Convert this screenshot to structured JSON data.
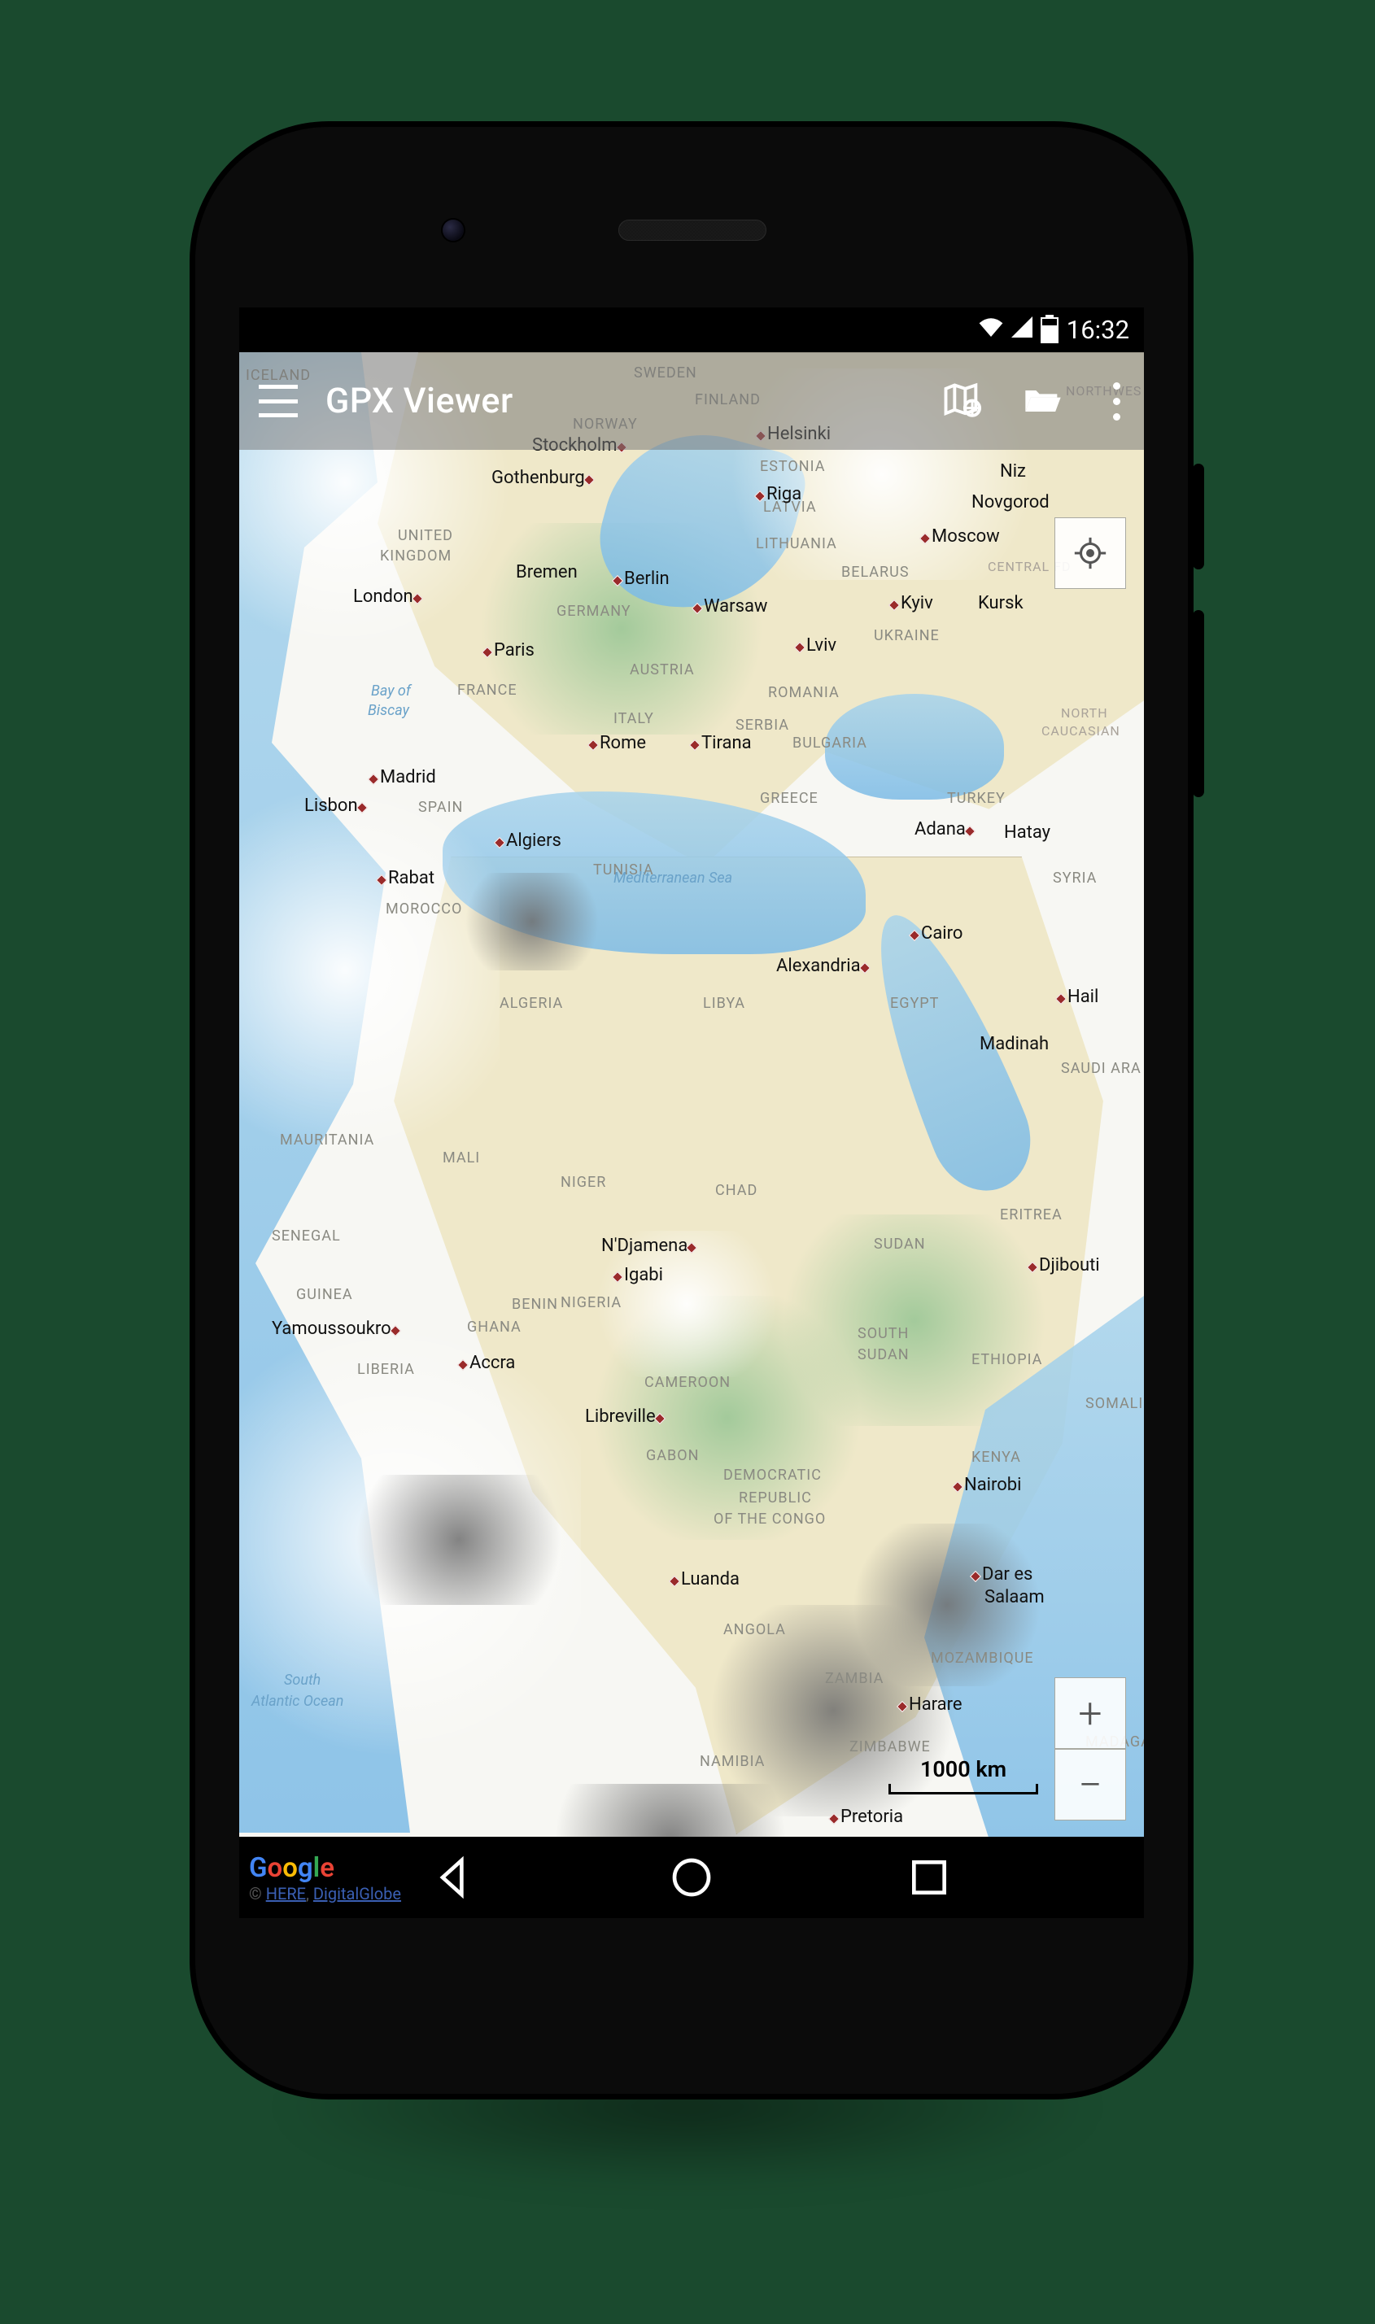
{
  "status": {
    "time": "16:32"
  },
  "appbar": {
    "title": "GPX Viewer"
  },
  "controls": {
    "zoom_in": "+",
    "zoom_out": "−",
    "scale_label": "1000 km"
  },
  "attribution": {
    "logo": "Google",
    "copyright_symbol": "©",
    "provider1": "HERE",
    "separator": ", ",
    "provider2": "DigitalGlobe"
  },
  "cities": {
    "stockholm": {
      "label": "Stockholm"
    },
    "gothenburg": {
      "label": "Gothenburg"
    },
    "helsinki": {
      "label": "Helsinki"
    },
    "riga": {
      "label": "Riga"
    },
    "niz": {
      "label": "Niz"
    },
    "novgorod": {
      "label": "Novgorod"
    },
    "moscow": {
      "label": "Moscow"
    },
    "london": {
      "label": "London"
    },
    "bremen": {
      "label": "Bremen"
    },
    "berlin": {
      "label": "Berlin"
    },
    "warsaw": {
      "label": "Warsaw"
    },
    "kyiv": {
      "label": "Kyiv"
    },
    "kursk": {
      "label": "Kursk"
    },
    "paris": {
      "label": "Paris"
    },
    "lviv": {
      "label": "Lviv"
    },
    "madrid": {
      "label": "Madrid"
    },
    "rome": {
      "label": "Rome"
    },
    "tirana": {
      "label": "Tirana"
    },
    "adana": {
      "label": "Adana"
    },
    "hatay": {
      "label": "Hatay"
    },
    "lisbon": {
      "label": "Lisbon"
    },
    "algiers": {
      "label": "Algiers"
    },
    "rabat": {
      "label": "Rabat"
    },
    "cairo": {
      "label": "Cairo"
    },
    "alexandria": {
      "label": "Alexandria"
    },
    "hail": {
      "label": "Hail"
    },
    "madinah": {
      "label": "Madinah"
    },
    "ndjamena": {
      "label": "N'Djamena"
    },
    "igabi": {
      "label": "Igabi"
    },
    "djibouti": {
      "label": "Djibouti"
    },
    "yamoussoukro": {
      "label": "Yamoussoukro"
    },
    "accra": {
      "label": "Accra"
    },
    "libreville": {
      "label": "Libreville"
    },
    "luanda": {
      "label": "Luanda"
    },
    "nairobi": {
      "label": "Nairobi"
    },
    "dares": {
      "label": "Dar es"
    },
    "salaam": {
      "label": "Salaam"
    },
    "harare": {
      "label": "Harare"
    },
    "pretoria": {
      "label": "Pretoria"
    }
  },
  "countries": {
    "iceland": "ICELAND",
    "sweden": "SWEDEN",
    "finland": "FINLAND",
    "norway": "NORWAY",
    "estonia": "ESTONIA",
    "latvia": "LATVIA",
    "lithuania": "LITHUANIA",
    "belarus": "BELARUS",
    "uk": "UNITED",
    "kingdom": "KINGDOM",
    "germany": "GERMANY",
    "france": "FRANCE",
    "austria": "AUSTRIA",
    "italy": "ITALY",
    "spain": "SPAIN",
    "romania": "ROMANIA",
    "serbia": "SERBIA",
    "bulgaria": "BULGARIA",
    "greece": "GREECE",
    "ukraine": "UKRAINE",
    "turkey": "TURKEY",
    "morocco": "MOROCCO",
    "tunisia": "TUNISIA",
    "algeria": "ALGERIA",
    "libya": "LIBYA",
    "egypt": "EGYPT",
    "syria": "SYRIA",
    "saudi": "SAUDI ARA",
    "mauritania": "MAURITANIA",
    "mali": "MALI",
    "niger": "NIGER",
    "chad": "CHAD",
    "sudan": "SUDAN",
    "eritrea": "ERITREA",
    "senegal": "SENEGAL",
    "guinea": "GUINEA",
    "ghana": "GHANA",
    "benin": "BENIN",
    "nigeria": "NIGERIA",
    "liberia": "LIBERIA",
    "cameroon": "CAMEROON",
    "ssudan": "SOUTH",
    "ssudan2": "SUDAN",
    "ethiopia": "ETHIOPIA",
    "somalia": "SOMALI",
    "gabon": "GABON",
    "drc1": "DEMOCRATIC",
    "drc2": "REPUBLIC",
    "drc3": "OF THE CONGO",
    "kenya": "KENYA",
    "angola": "ANGOLA",
    "zambia": "ZAMBIA",
    "moz": "MOZAMBIQUE",
    "zimbabwe": "ZIMBABWE",
    "namibia": "NAMIBIA",
    "madagascar": "MADAGA",
    "northwest": "NORTHWES",
    "centralfd": "CENTRAL FD",
    "ncaucasian1": "NORTH",
    "ncaucasian2": "CAUCASIAN"
  },
  "water": {
    "biscay1": "Bay of",
    "biscay2": "Biscay",
    "medsea": "Mediterranean Sea",
    "satl1": "South",
    "satl2": "Atlantic Ocean"
  }
}
